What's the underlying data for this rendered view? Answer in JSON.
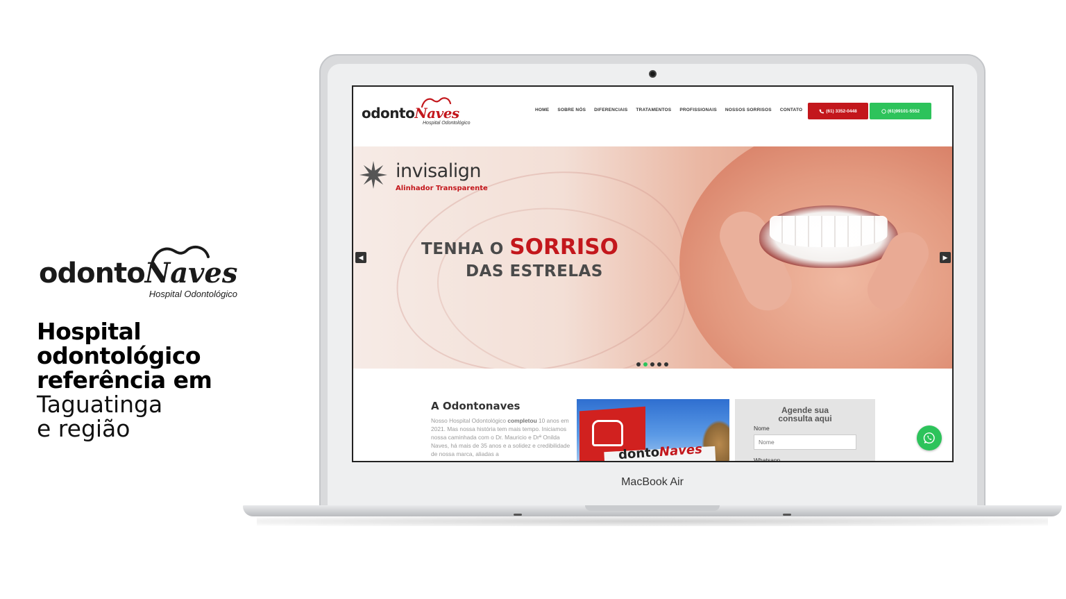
{
  "promo": {
    "logo_word_a": "odonto",
    "logo_word_b": "Naves",
    "logo_sub": "Hospital Odontológico",
    "headline_line1": "Hospital",
    "headline_line2": "odontológico",
    "headline_line3": "referência em",
    "light_line1": "Taguatinga",
    "light_line2": "e região"
  },
  "device": {
    "model_label": "MacBook Air"
  },
  "site": {
    "logo_word_a": "odonto",
    "logo_word_b": "Naves",
    "logo_sub": "Hospital Odontológico",
    "nav": [
      "HOME",
      "SOBRE NÓS",
      "DIFERENCIAIS",
      "TRATAMENTOS",
      "PROFISSIONAIS",
      "NOSSOS SORRISOS",
      "CONTATO"
    ],
    "phone_button": "(61) 3352-0448",
    "whatsapp_button": "(61)99101-5552",
    "hero": {
      "brand": "invisalign",
      "brand_sub": "Alinhador Transparente",
      "line1_a": "TENHA O",
      "line1_b": "SORRISO",
      "line2": "DAS ESTRELAS",
      "prev_arrow": "◀",
      "next_arrow": "▶",
      "slide_count": 5,
      "active_slide": 2
    },
    "about": {
      "title": "A Odontonaves",
      "text_a": "Nosso Hospital Odontológico ",
      "text_bold": "completou",
      "text_b": " 10 anos em 2021. Mas nossa história tem mais tempo. Iniciamos nossa caminhada com o Dr. Mauricio e Drª Onilda Naves, há mais de 35 anos e a solidez e credibilidade de nossa marca, aliadas a"
    },
    "building_sign": {
      "word_a": "donto",
      "word_b": "Naves"
    },
    "form": {
      "title_line1": "Agende sua",
      "title_line2": "consulta aqui",
      "name_label": "Nome",
      "name_placeholder": "Nome",
      "whatsapp_label": "Whatsapp"
    }
  },
  "colors": {
    "brand_red": "#c3171c",
    "whatsapp_green": "#2dc35b"
  },
  "icons": [
    "tooth-icon",
    "phone-icon",
    "whatsapp-icon",
    "invisalign-star-icon",
    "prev-arrow-icon",
    "next-arrow-icon"
  ]
}
